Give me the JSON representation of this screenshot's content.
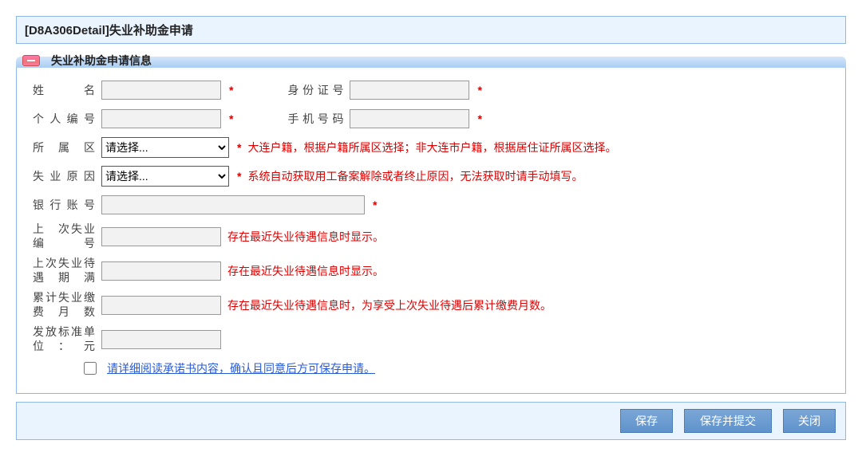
{
  "page": {
    "title": "[D8A306Detail]失业补助金申请"
  },
  "panel": {
    "title": "失业补助金申请信息"
  },
  "labels": {
    "name": "姓　名",
    "id_number": "身份证号",
    "personal_no": "个人编号",
    "phone": "手机号码",
    "district": "所 属 区",
    "reason": "失业原因",
    "bank_account": "银行账号",
    "last_unemp_no": "上　次失业编号",
    "last_expire": "上次失业待遇期满",
    "accum_months": "累计失业缴费月数",
    "standard": "发放标准单位：元"
  },
  "values": {
    "name": "",
    "id_number": "",
    "personal_no": "",
    "phone": "",
    "bank_account": "",
    "last_unemp_no": "",
    "last_expire": "",
    "accum_months": "",
    "standard": ""
  },
  "selects": {
    "district_placeholder": "请选择...",
    "reason_placeholder": "请选择..."
  },
  "hints": {
    "asterisk": "*",
    "district": "大连户籍，根据户籍所属区选择；非大连市户籍，根据居住证所属区选择。",
    "reason": "系统自动获取用工备案解除或者终止原因，无法获取时请手动填写。",
    "last_unemp_no": "存在最近失业待遇信息时显示。",
    "last_expire": "存在最近失业待遇信息时显示。",
    "accum_months": "存在最近失业待遇信息时，为享受上次失业待遇后累计缴费月数。"
  },
  "terms": {
    "link_text": "请详细阅读承诺书内容，确认且同意后方可保存申请。"
  },
  "buttons": {
    "save": "保存",
    "save_submit": "保存并提交",
    "close": "关闭"
  }
}
